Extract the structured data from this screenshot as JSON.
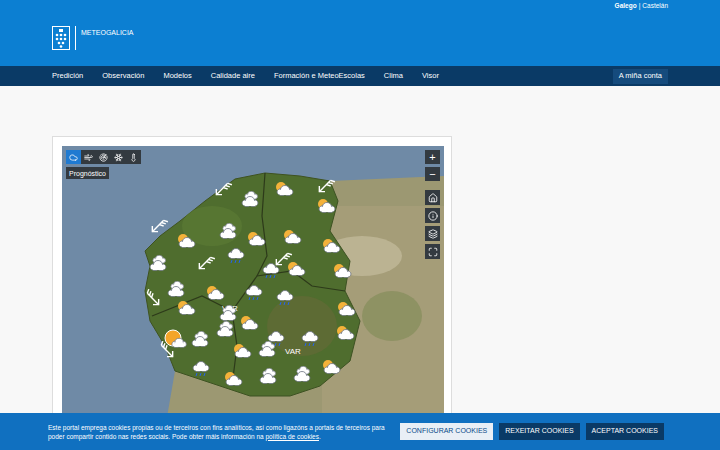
{
  "header": {
    "site_name": "METEOGALICIA",
    "languages": [
      {
        "label": "Galego",
        "selected": true
      },
      {
        "label": "Castelán",
        "selected": false
      }
    ],
    "separator": "|"
  },
  "nav": {
    "items": [
      "Predición",
      "Observación",
      "Modelos",
      "Calidade aire",
      "Formación e MeteoEscolas",
      "Clima",
      "Visor"
    ],
    "account": "A miña conta"
  },
  "map": {
    "toolbar": [
      {
        "selected": true
      },
      {
        "selected": false
      },
      {
        "selected": false
      },
      {
        "selected": false
      },
      {
        "selected": false
      }
    ],
    "tooltip": "Prognóstico",
    "zoom_in": "+",
    "zoom_out": "−",
    "zone_labels": [
      "VAR",
      "VAR"
    ],
    "symbols": [
      {
        "kind": "wind"
      },
      {
        "kind": "wind"
      },
      {
        "kind": "wind"
      },
      {
        "kind": "wind"
      },
      {
        "kind": "wind"
      },
      {
        "kind": "wind"
      },
      {
        "kind": "wind"
      },
      {
        "kind": "sun-cloud"
      },
      {
        "kind": "cloudy"
      },
      {
        "kind": "sun-cloud"
      },
      {
        "kind": "sun-cloud"
      },
      {
        "kind": "cloudy"
      },
      {
        "kind": "sun-cloud"
      },
      {
        "kind": "sun-cloud"
      },
      {
        "kind": "sun-cloud"
      },
      {
        "kind": "cloudy"
      },
      {
        "kind": "rain"
      },
      {
        "kind": "rain"
      },
      {
        "kind": "sun-cloud"
      },
      {
        "kind": "sun-cloud"
      },
      {
        "kind": "cloudy"
      },
      {
        "kind": "sun-cloud"
      },
      {
        "kind": "rain"
      },
      {
        "kind": "rain"
      },
      {
        "kind": "sun-cloud"
      },
      {
        "kind": "cloudy"
      },
      {
        "kind": "sun-cloud"
      },
      {
        "kind": "sun"
      },
      {
        "kind": "cloudy"
      },
      {
        "kind": "cloudy"
      },
      {
        "kind": "sun-cloud"
      },
      {
        "kind": "rain"
      },
      {
        "kind": "rain"
      },
      {
        "kind": "sun-cloud"
      },
      {
        "kind": "sun-cloud"
      },
      {
        "kind": "cloudy"
      },
      {
        "kind": "rain"
      },
      {
        "kind": "cloudy"
      },
      {
        "kind": "sun-cloud"
      },
      {
        "kind": "cloudy"
      },
      {
        "kind": "sun-cloud"
      }
    ]
  },
  "cookie_banner": {
    "text": "Este portal emprega cookies propias ou de terceiros con fins analíticos, así como ligazóns a portais de terceiros para poder compartir contido nas redes sociais. Pode obter máis información na ",
    "link": "política de cookies",
    "text_end": ".",
    "buttons": [
      {
        "label": "CONFIGURAR COOKIES",
        "kind": "secondary"
      },
      {
        "label": "REXEITAR COOKIES",
        "kind": "primary"
      },
      {
        "label": "ACEPTAR COOKIES",
        "kind": "primary"
      }
    ]
  }
}
